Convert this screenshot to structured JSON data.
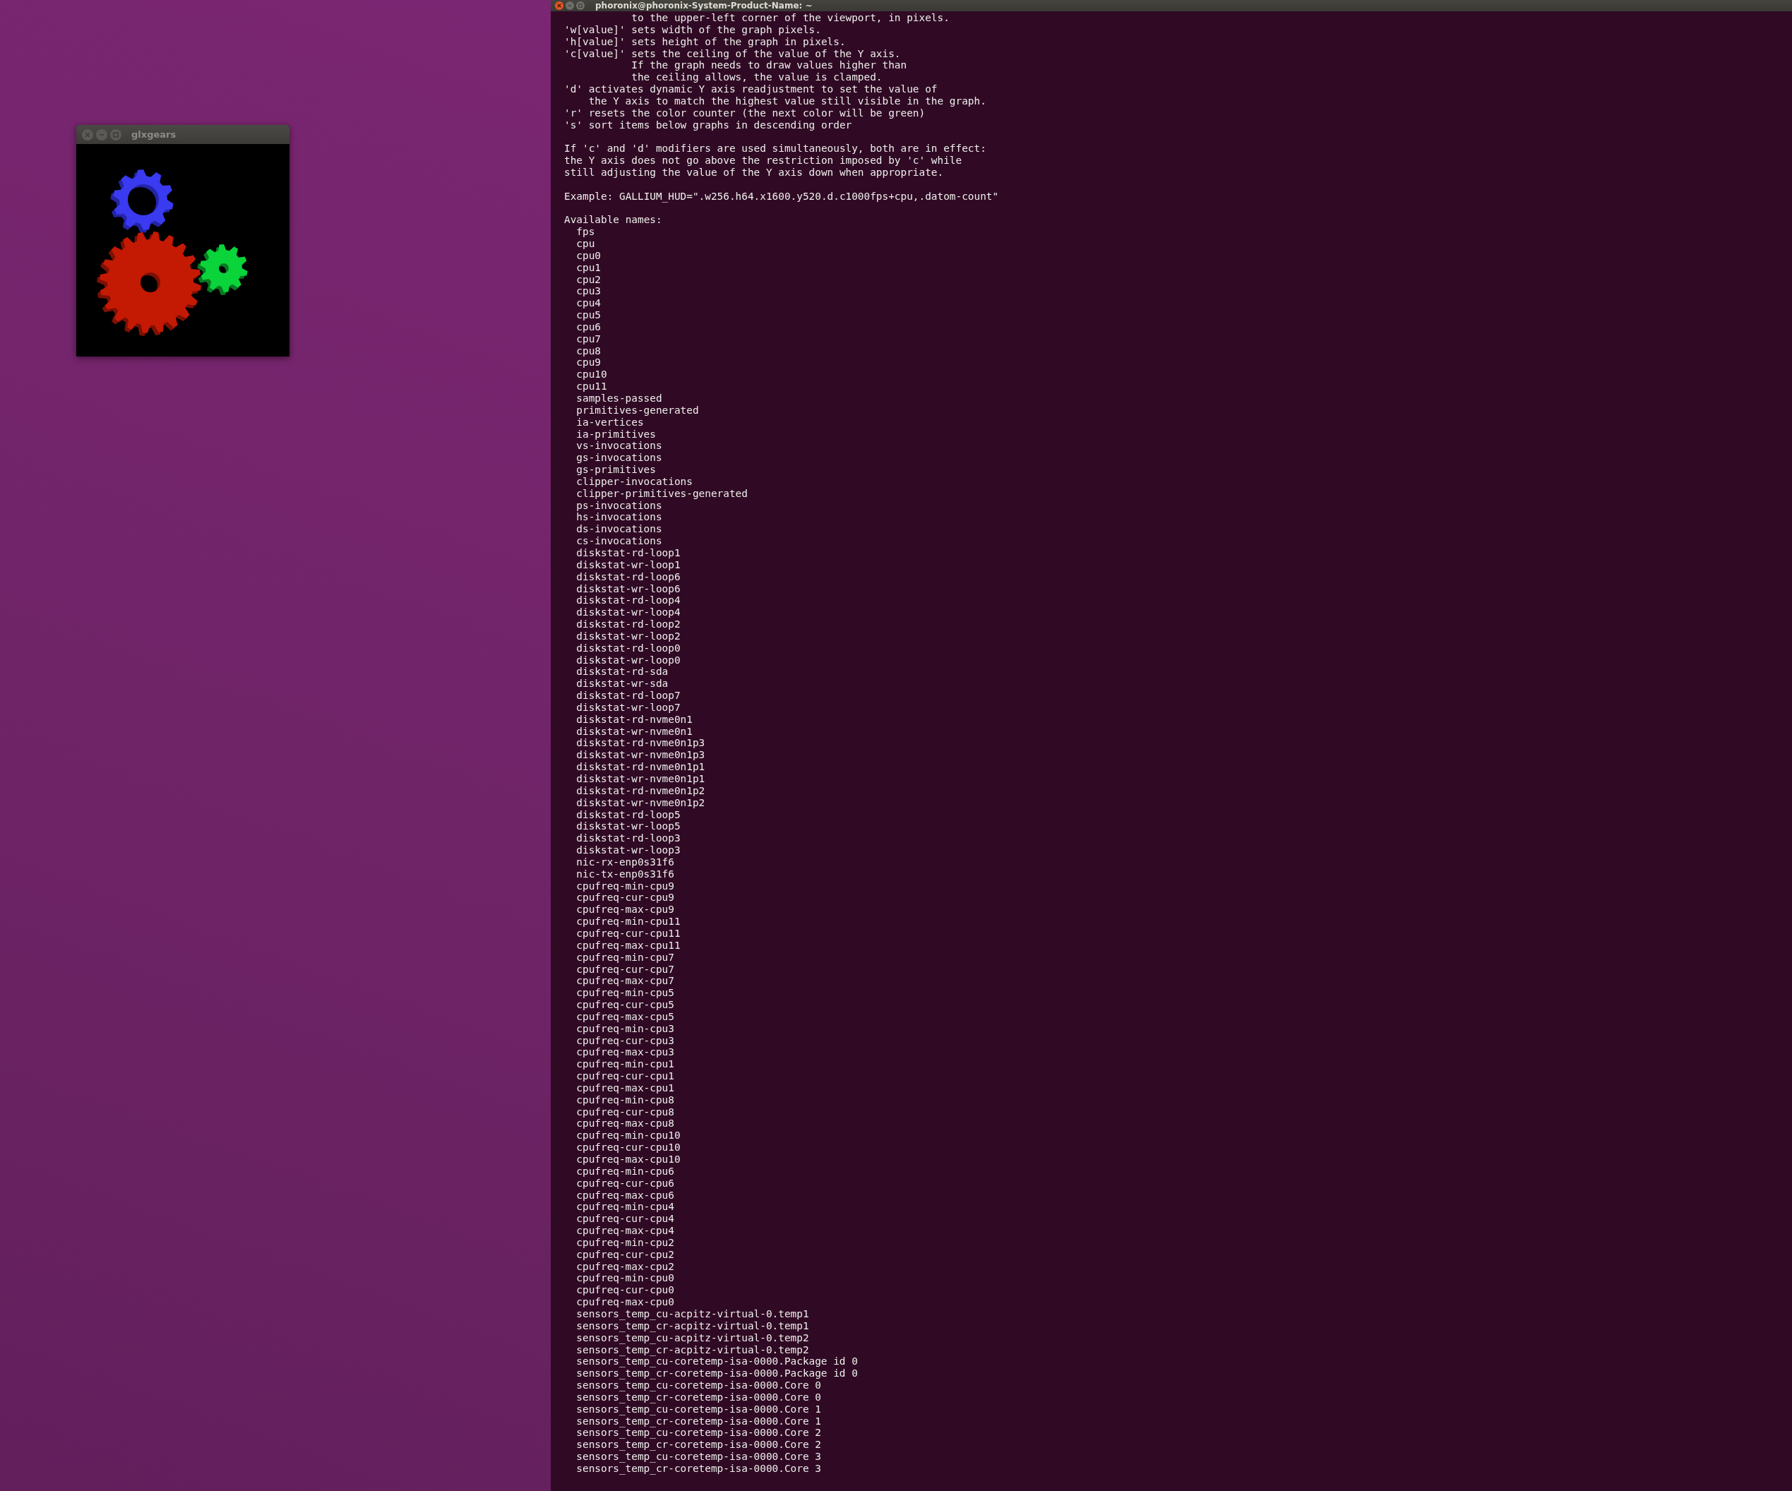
{
  "glxgears": {
    "title": "glxgears"
  },
  "terminal": {
    "title": "phoronix@phoronix-System-Product-Name: ~",
    "sections": [
      {
        "lines": [
          {
            "kind": "continuation",
            "text": "to the upper-left corner of the viewport, in pixels."
          },
          {
            "kind": "plain",
            "text": "'w[value]' sets width of the graph pixels."
          },
          {
            "kind": "plain",
            "text": "'h[value]' sets height of the graph in pixels."
          },
          {
            "kind": "plain",
            "text": "'c[value]' sets the ceiling of the value of the Y axis."
          },
          {
            "kind": "continuation",
            "text": "If the graph needs to draw values higher than"
          },
          {
            "kind": "continuation",
            "text": "the ceiling allows, the value is clamped."
          },
          {
            "kind": "plain",
            "text": "'d' activates dynamic Y axis readjustment to set the value of"
          },
          {
            "kind": "wrap",
            "text": "the Y axis to match the highest value still visible in the graph."
          },
          {
            "kind": "plain",
            "text": "'r' resets the color counter (the next color will be green)"
          },
          {
            "kind": "plain",
            "text": "'s' sort items below graphs in descending order"
          }
        ]
      },
      {
        "lines": [
          {
            "kind": "plain",
            "text": "If 'c' and 'd' modifiers are used simultaneously, both are in effect:"
          },
          {
            "kind": "plain",
            "text": "the Y axis does not go above the restriction imposed by 'c' while"
          },
          {
            "kind": "plain",
            "text": "still adjusting the value of the Y axis down when appropriate."
          }
        ]
      },
      {
        "lines": [
          {
            "kind": "plain",
            "text": "Example: GALLIUM_HUD=\".w256.h64.x1600.y520.d.c1000fps+cpu,.datom-count\""
          }
        ]
      }
    ],
    "names_heading": "Available names:",
    "names": [
      "fps",
      "cpu",
      "cpu0",
      "cpu1",
      "cpu2",
      "cpu3",
      "cpu4",
      "cpu5",
      "cpu6",
      "cpu7",
      "cpu8",
      "cpu9",
      "cpu10",
      "cpu11",
      "samples-passed",
      "primitives-generated",
      "ia-vertices",
      "ia-primitives",
      "vs-invocations",
      "gs-invocations",
      "gs-primitives",
      "clipper-invocations",
      "clipper-primitives-generated",
      "ps-invocations",
      "hs-invocations",
      "ds-invocations",
      "cs-invocations",
      "diskstat-rd-loop1",
      "diskstat-wr-loop1",
      "diskstat-rd-loop6",
      "diskstat-wr-loop6",
      "diskstat-rd-loop4",
      "diskstat-wr-loop4",
      "diskstat-rd-loop2",
      "diskstat-wr-loop2",
      "diskstat-rd-loop0",
      "diskstat-wr-loop0",
      "diskstat-rd-sda",
      "diskstat-wr-sda",
      "diskstat-rd-loop7",
      "diskstat-wr-loop7",
      "diskstat-rd-nvme0n1",
      "diskstat-wr-nvme0n1",
      "diskstat-rd-nvme0n1p3",
      "diskstat-wr-nvme0n1p3",
      "diskstat-rd-nvme0n1p1",
      "diskstat-wr-nvme0n1p1",
      "diskstat-rd-nvme0n1p2",
      "diskstat-wr-nvme0n1p2",
      "diskstat-rd-loop5",
      "diskstat-wr-loop5",
      "diskstat-rd-loop3",
      "diskstat-wr-loop3",
      "nic-rx-enp0s31f6",
      "nic-tx-enp0s31f6",
      "cpufreq-min-cpu9",
      "cpufreq-cur-cpu9",
      "cpufreq-max-cpu9",
      "cpufreq-min-cpu11",
      "cpufreq-cur-cpu11",
      "cpufreq-max-cpu11",
      "cpufreq-min-cpu7",
      "cpufreq-cur-cpu7",
      "cpufreq-max-cpu7",
      "cpufreq-min-cpu5",
      "cpufreq-cur-cpu5",
      "cpufreq-max-cpu5",
      "cpufreq-min-cpu3",
      "cpufreq-cur-cpu3",
      "cpufreq-max-cpu3",
      "cpufreq-min-cpu1",
      "cpufreq-cur-cpu1",
      "cpufreq-max-cpu1",
      "cpufreq-min-cpu8",
      "cpufreq-cur-cpu8",
      "cpufreq-max-cpu8",
      "cpufreq-min-cpu10",
      "cpufreq-cur-cpu10",
      "cpufreq-max-cpu10",
      "cpufreq-min-cpu6",
      "cpufreq-cur-cpu6",
      "cpufreq-max-cpu6",
      "cpufreq-min-cpu4",
      "cpufreq-cur-cpu4",
      "cpufreq-max-cpu4",
      "cpufreq-min-cpu2",
      "cpufreq-cur-cpu2",
      "cpufreq-max-cpu2",
      "cpufreq-min-cpu0",
      "cpufreq-cur-cpu0",
      "cpufreq-max-cpu0",
      "sensors_temp_cu-acpitz-virtual-0.temp1",
      "sensors_temp_cr-acpitz-virtual-0.temp1",
      "sensors_temp_cu-acpitz-virtual-0.temp2",
      "sensors_temp_cr-acpitz-virtual-0.temp2",
      "sensors_temp_cu-coretemp-isa-0000.Package id 0",
      "sensors_temp_cr-coretemp-isa-0000.Package id 0",
      "sensors_temp_cu-coretemp-isa-0000.Core 0",
      "sensors_temp_cr-coretemp-isa-0000.Core 0",
      "sensors_temp_cu-coretemp-isa-0000.Core 1",
      "sensors_temp_cr-coretemp-isa-0000.Core 1",
      "sensors_temp_cu-coretemp-isa-0000.Core 2",
      "sensors_temp_cr-coretemp-isa-0000.Core 2",
      "sensors_temp_cu-coretemp-isa-0000.Core 3",
      "sensors_temp_cr-coretemp-isa-0000.Core 3"
    ]
  }
}
